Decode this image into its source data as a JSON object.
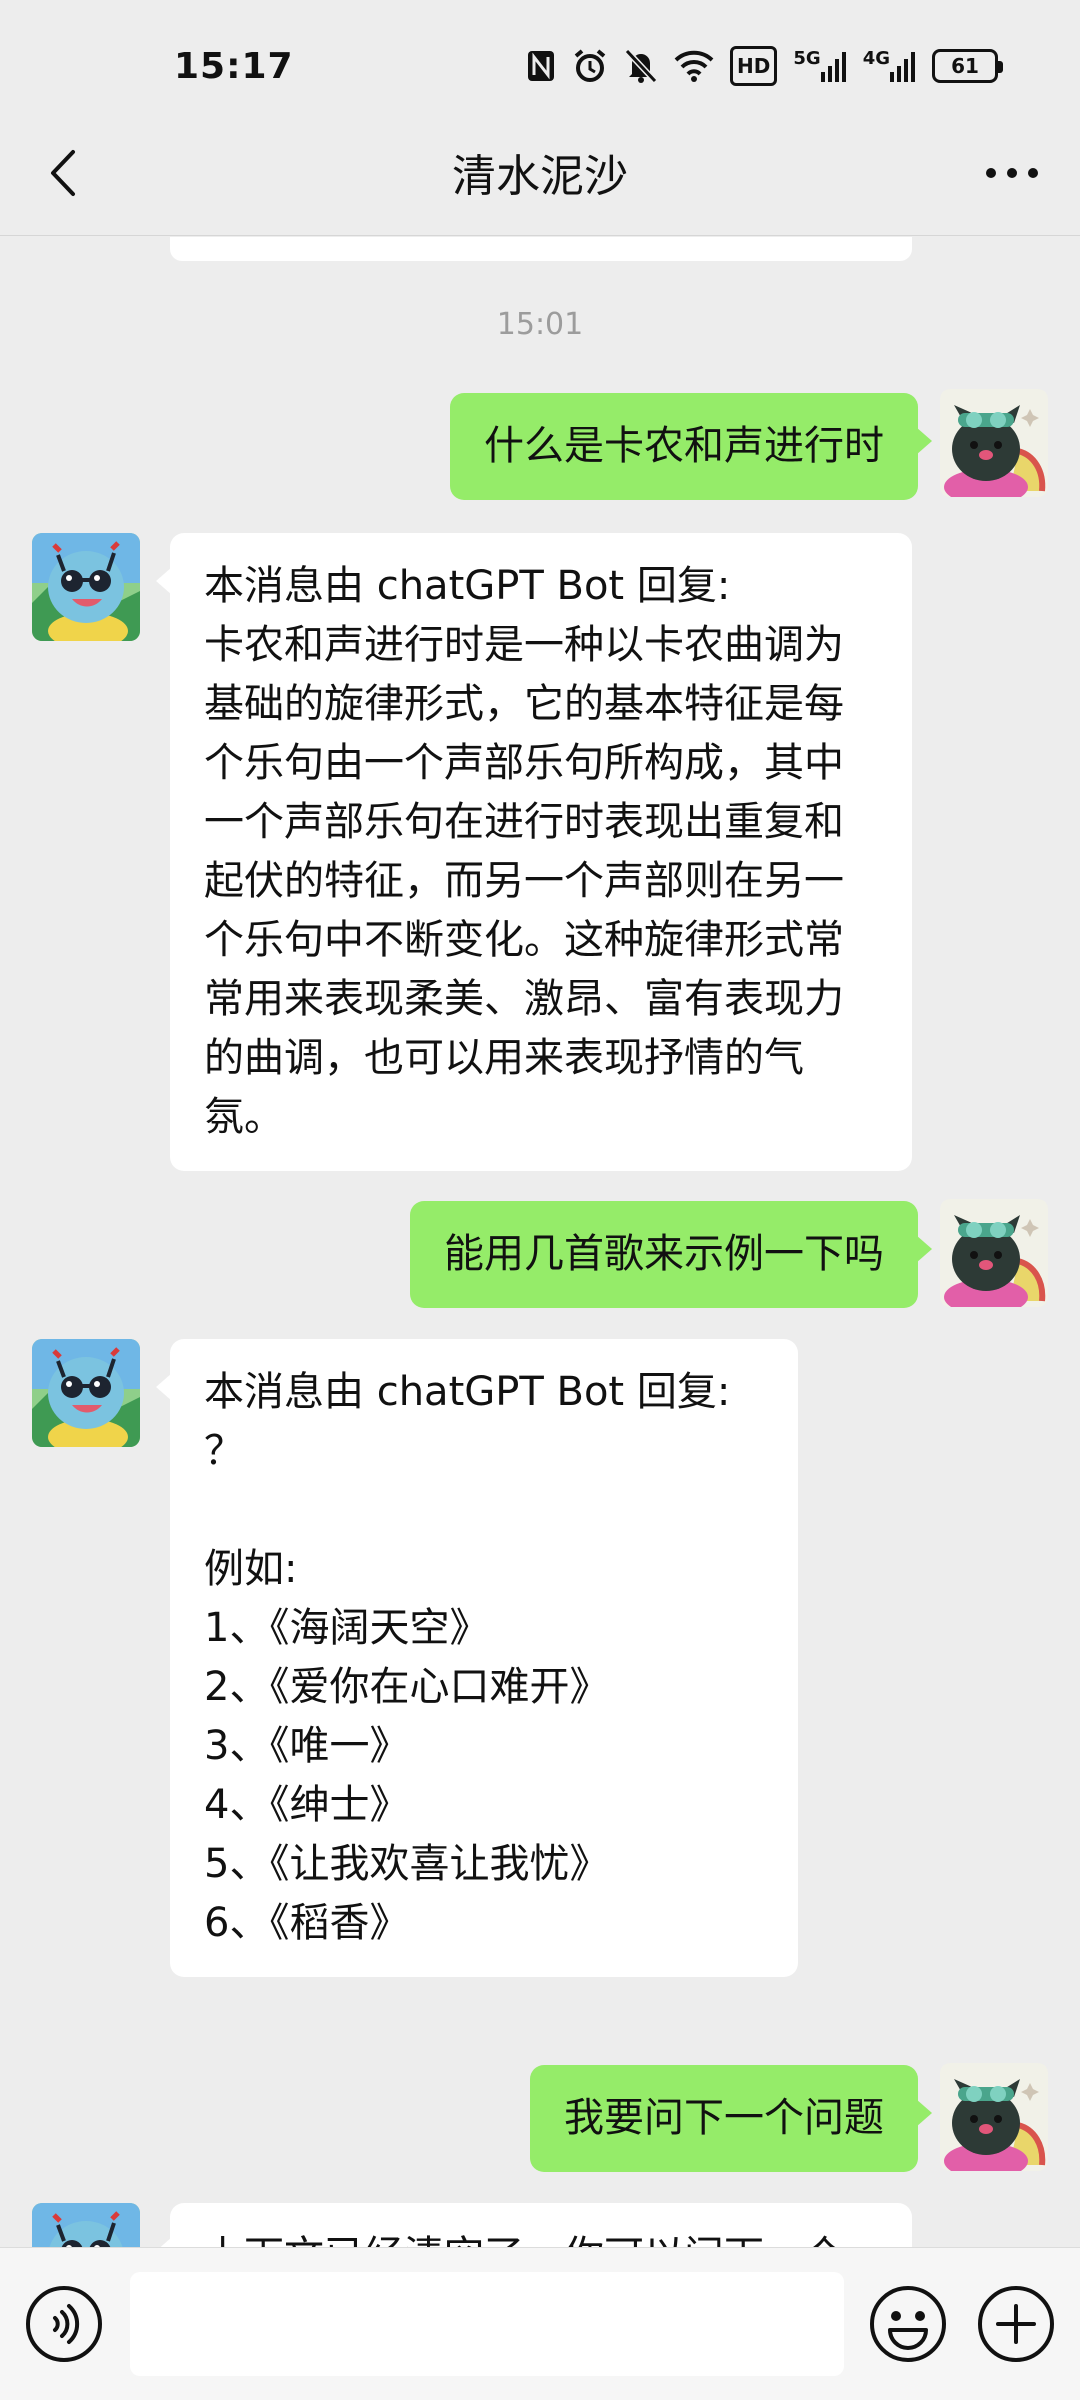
{
  "status_bar": {
    "time": "15:17",
    "hd_label": "HD",
    "net1": "5G",
    "net2": "4G",
    "battery": "61"
  },
  "header": {
    "title": "清水泥沙"
  },
  "chat": {
    "timestamp": "15:01",
    "messages": [
      {
        "from": "me",
        "text": "什么是卡农和声进行时"
      },
      {
        "from": "bot",
        "text": "本消息由 chatGPT Bot 回复:\n卡农和声进行时是一种以卡农曲调为基础的旋律形式，它的基本特征是每个乐句由一个声部乐句所构成，其中一个声部乐句在进行时表现出重复和起伏的特征，而另一个声部则在另一个乐句中不断变化。这种旋律形式常常用来表现柔美、激昂、富有表现力的曲调，也可以用来表现抒情的气氛。"
      },
      {
        "from": "me",
        "text": "能用几首歌来示例一下吗"
      },
      {
        "from": "bot",
        "text": "本消息由 chatGPT Bot 回复:\n？\n\n例如:\n1、《海阔天空》\n2、《爱你在心口难开》\n3、《唯一》\n4、《绅士》\n5、《让我欢喜让我忧》\n6、《稻香》"
      },
      {
        "from": "me",
        "text": "我要问下一个问题"
      },
      {
        "from": "bot",
        "text": "上下文已经清空了，你可以问下一个问题了"
      }
    ]
  },
  "input": {
    "value": ""
  },
  "colors": {
    "background": "#ededed",
    "my_bubble": "#95ec69",
    "bot_bubble": "#ffffff"
  },
  "icons": {
    "back": "chevron-left-icon",
    "more": "more-dots-icon",
    "voice": "voice-icon",
    "emoji": "emoji-icon",
    "plus": "plus-icon"
  }
}
